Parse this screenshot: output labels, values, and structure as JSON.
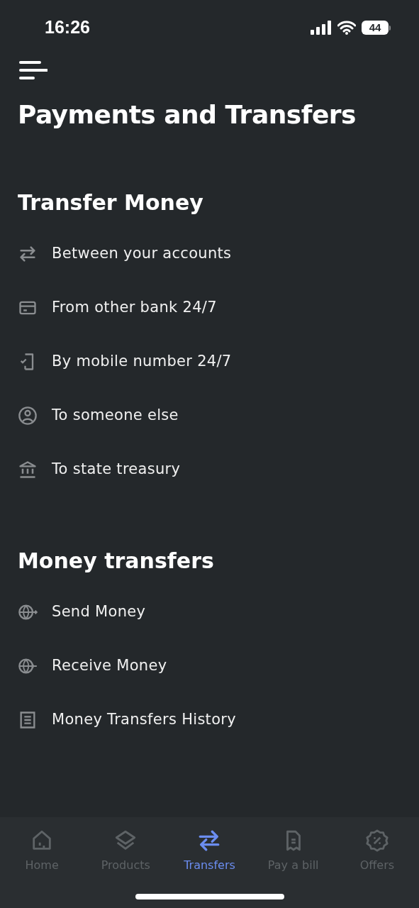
{
  "status_bar": {
    "time": "16:26",
    "battery": "44"
  },
  "title": "Payments and Transfers",
  "sections": [
    {
      "heading": "Transfer Money",
      "items": [
        "Between your accounts",
        "From other bank 24/7",
        "By mobile number 24/7",
        "To someone else",
        "To state treasury"
      ]
    },
    {
      "heading": "Money transfers",
      "items": [
        "Send Money",
        "Receive Money",
        "Money Transfers History"
      ]
    }
  ],
  "tab_bar": [
    {
      "label": "Home",
      "selected": false
    },
    {
      "label": "Products",
      "selected": false
    },
    {
      "label": "Transfers",
      "selected": true
    },
    {
      "label": "Pay a bill",
      "selected": false
    },
    {
      "label": "Offers",
      "selected": false
    }
  ]
}
